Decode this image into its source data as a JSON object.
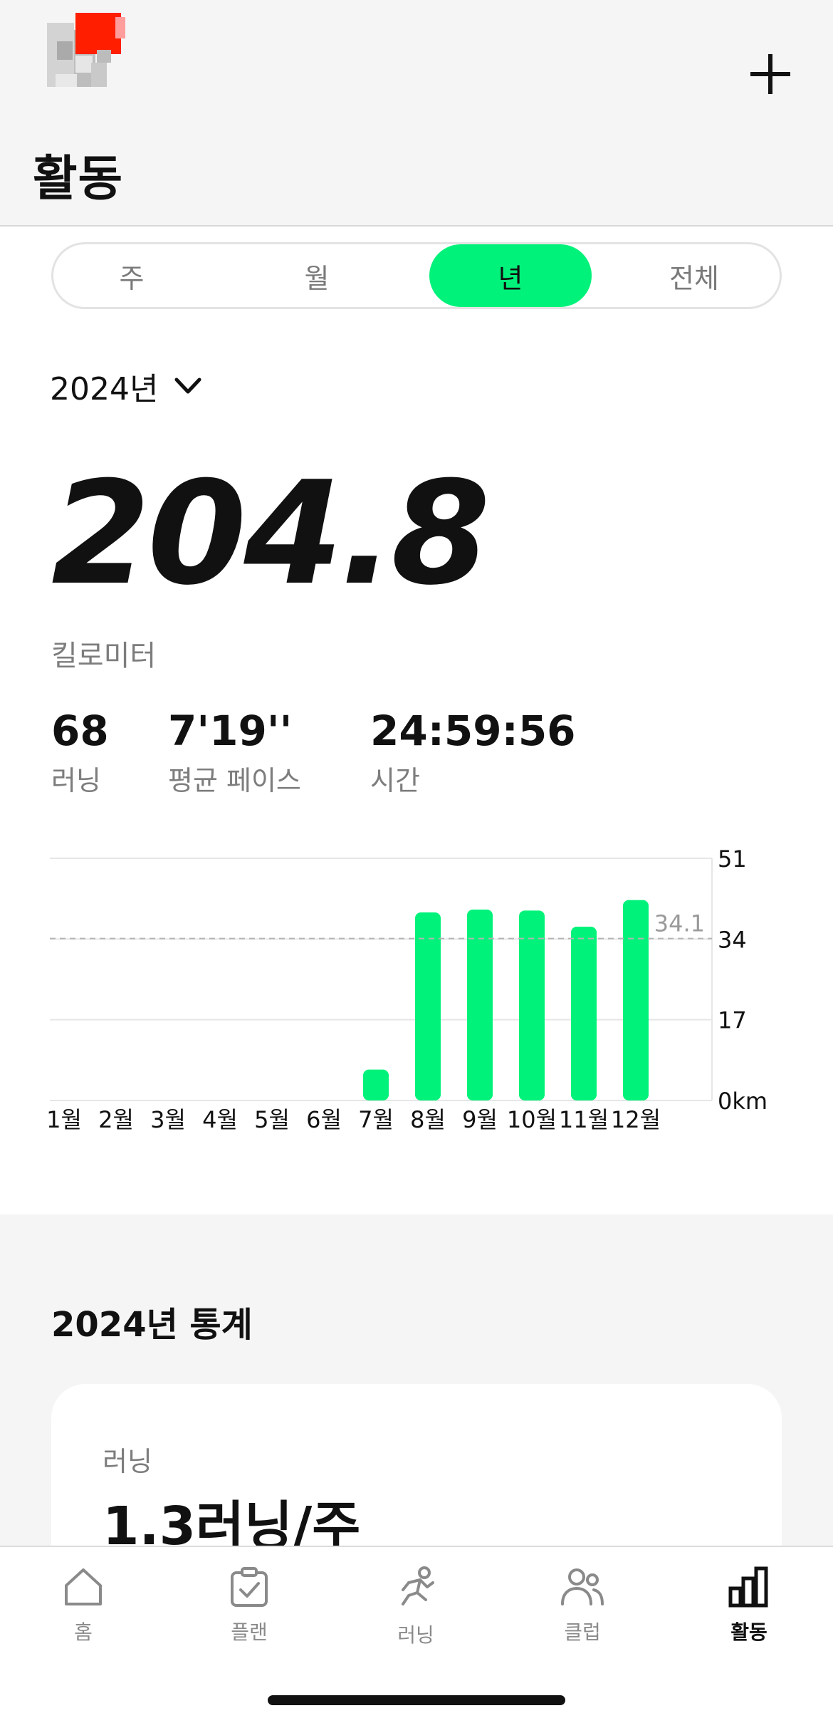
{
  "header": {
    "title": "활동",
    "add_icon": "plus-icon",
    "avatar_icon": "pixel-avatar"
  },
  "segmented": {
    "tabs": [
      "주",
      "월",
      "년",
      "전체"
    ],
    "active": "년"
  },
  "year_selector": {
    "label": "2024년",
    "icon": "chevron-down-icon"
  },
  "summary": {
    "distance": "204.8",
    "distance_unit": "킬로미터",
    "runs_value": "68",
    "runs_label": "러닝",
    "pace_value": "7'19''",
    "pace_label": "평균 페이스",
    "time_value": "24:59:56",
    "time_label": "시간"
  },
  "chart_data": {
    "type": "bar",
    "categories": [
      "1월",
      "2월",
      "3월",
      "4월",
      "5월",
      "6월",
      "7월",
      "8월",
      "9월",
      "10월",
      "11월",
      "12월"
    ],
    "values": [
      0,
      0,
      0,
      0,
      0,
      0,
      6.5,
      39.6,
      40.2,
      40.0,
      36.6,
      42.2
    ],
    "y_ticks": [
      "0km",
      "17",
      "34",
      "51"
    ],
    "ylim": [
      0,
      51
    ],
    "average": 34.1,
    "average_label": "34.1",
    "bar_color": "#00f27a",
    "grid": true
  },
  "stats": {
    "title": "2024년 통계",
    "card_label": "러닝",
    "card_value": "1.3러닝/주"
  },
  "nav": {
    "items": [
      {
        "label": "홈",
        "icon": "home-icon"
      },
      {
        "label": "플랜",
        "icon": "clipboard-check-icon"
      },
      {
        "label": "러닝",
        "icon": "runner-icon"
      },
      {
        "label": "클럽",
        "icon": "people-icon"
      },
      {
        "label": "활동",
        "icon": "bar-chart-icon"
      }
    ],
    "active": "활동"
  },
  "colors": {
    "accent": "#00f27a",
    "header_bg": "#f5f5f5",
    "muted_text": "#7d7d7d"
  }
}
